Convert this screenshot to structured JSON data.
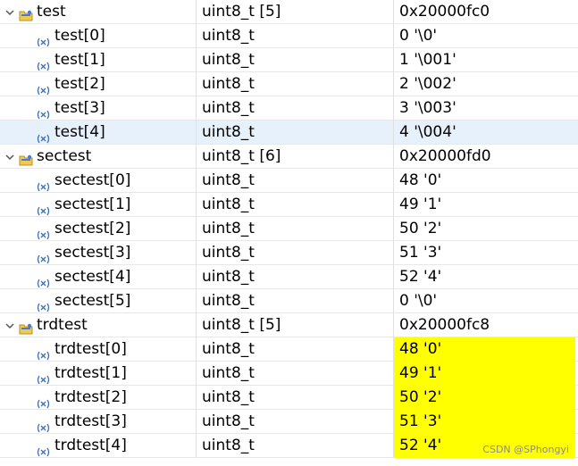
{
  "rows": [
    {
      "kind": "parent",
      "name": "test",
      "type": "uint8_t [5]",
      "value": "0x20000fc0",
      "selected": false,
      "changed": false
    },
    {
      "kind": "child",
      "name": "test[0]",
      "type": "uint8_t",
      "value": "0 '\\0'",
      "selected": false,
      "changed": false
    },
    {
      "kind": "child",
      "name": "test[1]",
      "type": "uint8_t",
      "value": "1 '\\001'",
      "selected": false,
      "changed": false
    },
    {
      "kind": "child",
      "name": "test[2]",
      "type": "uint8_t",
      "value": "2 '\\002'",
      "selected": false,
      "changed": false
    },
    {
      "kind": "child",
      "name": "test[3]",
      "type": "uint8_t",
      "value": "3 '\\003'",
      "selected": false,
      "changed": false
    },
    {
      "kind": "child",
      "name": "test[4]",
      "type": "uint8_t",
      "value": "4 '\\004'",
      "selected": true,
      "changed": false
    },
    {
      "kind": "parent",
      "name": "sectest",
      "type": "uint8_t [6]",
      "value": "0x20000fd0",
      "selected": false,
      "changed": false
    },
    {
      "kind": "child",
      "name": "sectest[0]",
      "type": "uint8_t",
      "value": "48 '0'",
      "selected": false,
      "changed": false
    },
    {
      "kind": "child",
      "name": "sectest[1]",
      "type": "uint8_t",
      "value": "49 '1'",
      "selected": false,
      "changed": false
    },
    {
      "kind": "child",
      "name": "sectest[2]",
      "type": "uint8_t",
      "value": "50 '2'",
      "selected": false,
      "changed": false
    },
    {
      "kind": "child",
      "name": "sectest[3]",
      "type": "uint8_t",
      "value": "51 '3'",
      "selected": false,
      "changed": false
    },
    {
      "kind": "child",
      "name": "sectest[4]",
      "type": "uint8_t",
      "value": "52 '4'",
      "selected": false,
      "changed": false
    },
    {
      "kind": "child",
      "name": "sectest[5]",
      "type": "uint8_t",
      "value": "0 '\\0'",
      "selected": false,
      "changed": false
    },
    {
      "kind": "parent",
      "name": "trdtest",
      "type": "uint8_t [5]",
      "value": "0x20000fc8",
      "selected": false,
      "changed": false
    },
    {
      "kind": "child",
      "name": "trdtest[0]",
      "type": "uint8_t",
      "value": "48 '0'",
      "selected": false,
      "changed": true
    },
    {
      "kind": "child",
      "name": "trdtest[1]",
      "type": "uint8_t",
      "value": "49 '1'",
      "selected": false,
      "changed": true
    },
    {
      "kind": "child",
      "name": "trdtest[2]",
      "type": "uint8_t",
      "value": "50 '2'",
      "selected": false,
      "changed": true
    },
    {
      "kind": "child",
      "name": "trdtest[3]",
      "type": "uint8_t",
      "value": "51 '3'",
      "selected": false,
      "changed": true
    },
    {
      "kind": "child",
      "name": "trdtest[4]",
      "type": "uint8_t",
      "value": "52 '4'",
      "selected": false,
      "changed": true
    }
  ],
  "icons": {
    "parent": "array-variable-icon",
    "child": "variable-icon",
    "expand": "chevron-down-icon"
  },
  "watermark": "CSDN @SPhongyi",
  "colors": {
    "changed_value": "#ffff00",
    "selected_row": "#e7f1fb"
  }
}
